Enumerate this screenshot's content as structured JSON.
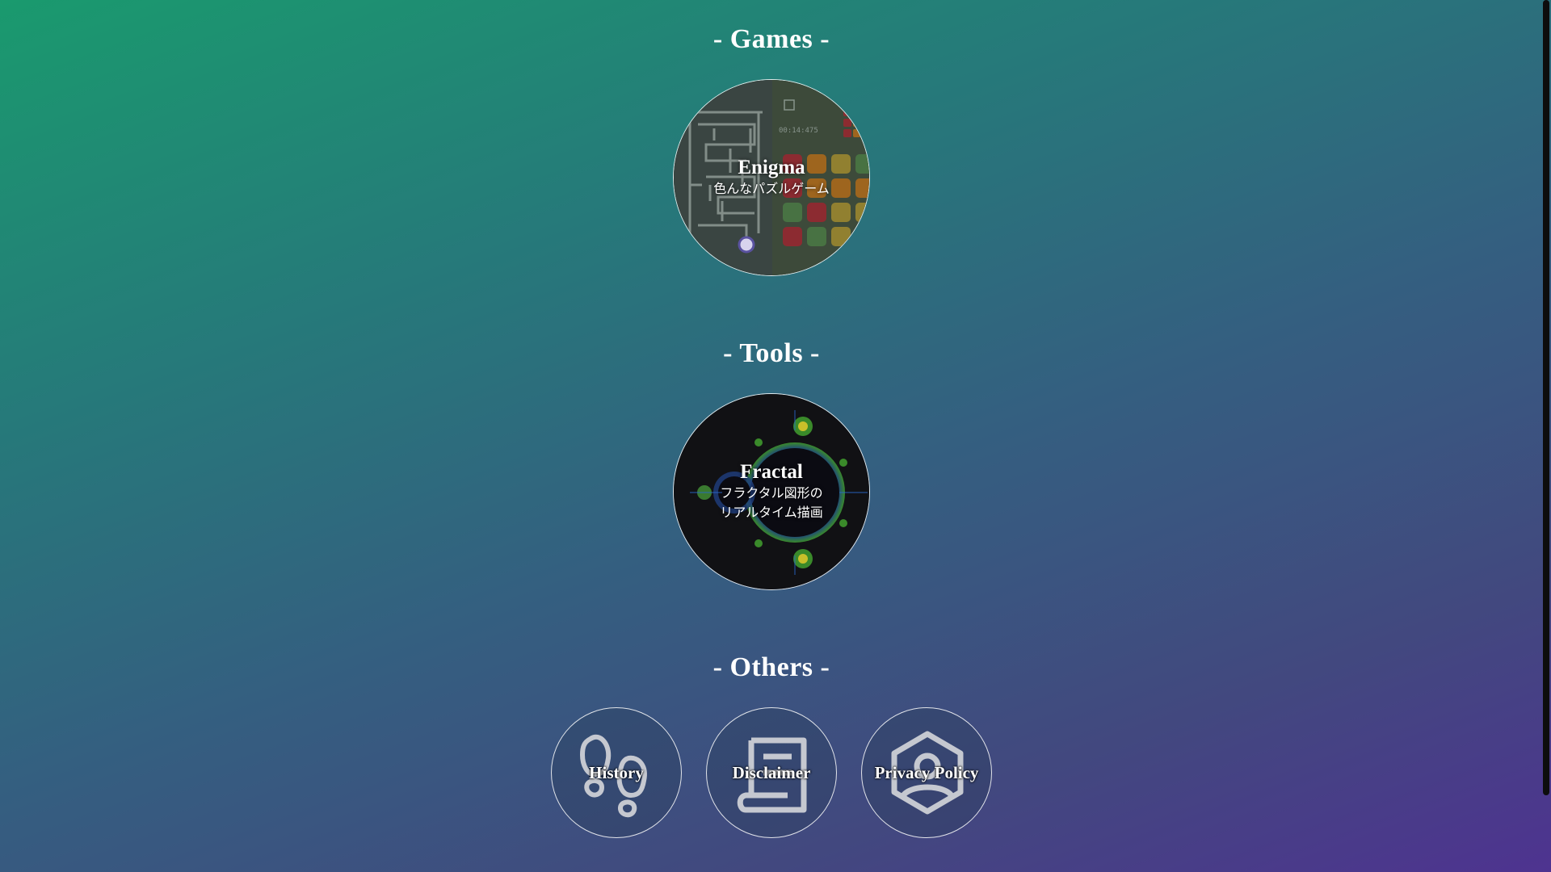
{
  "sections": {
    "games": {
      "title": "- Games -"
    },
    "tools": {
      "title": "- Tools -"
    },
    "others": {
      "title": "- Others -"
    }
  },
  "games": {
    "enigma": {
      "name": "Enigma",
      "description": "色んなパズルゲーム",
      "thumbnail_timer": "00:14:475"
    }
  },
  "tools": {
    "fractal": {
      "name": "Fractal",
      "description": "フラクタル図形の\nリアルタイム描画"
    }
  },
  "others": {
    "history": {
      "label": "History",
      "icon": "footprints-icon"
    },
    "disclaimer": {
      "label": "Disclaimer",
      "icon": "scroll-icon"
    },
    "privacy": {
      "label": "Privacy Policy",
      "icon": "shield-user-icon"
    }
  }
}
